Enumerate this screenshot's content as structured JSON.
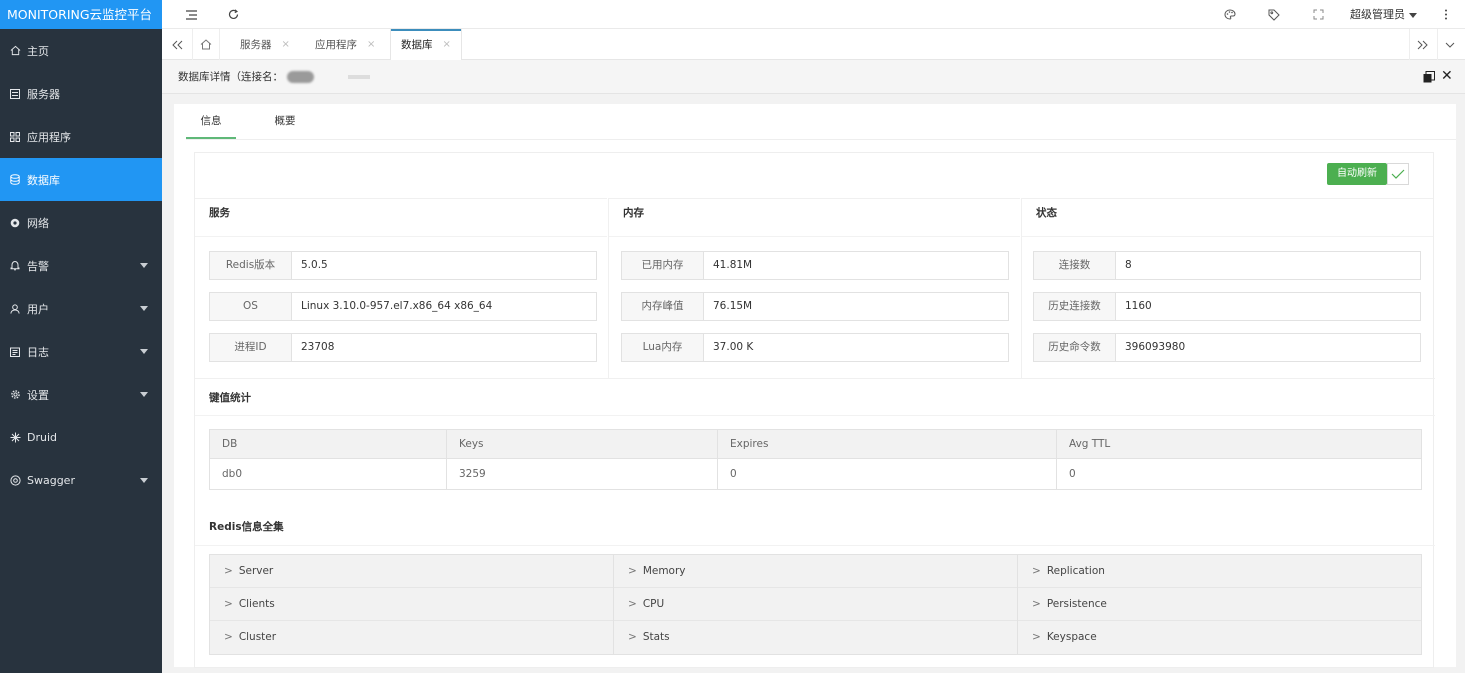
{
  "app": {
    "title": "MONITORING云监控平台"
  },
  "sidebar": {
    "items": [
      {
        "label": "主页",
        "icon": "home-icon"
      },
      {
        "label": "服务器",
        "icon": "server-icon"
      },
      {
        "label": "应用程序",
        "icon": "apps-icon"
      },
      {
        "label": "数据库",
        "icon": "database-icon",
        "active": true
      },
      {
        "label": "网络",
        "icon": "network-icon"
      },
      {
        "label": "告警",
        "icon": "bell-icon",
        "expandable": true
      },
      {
        "label": "用户",
        "icon": "user-icon",
        "expandable": true
      },
      {
        "label": "日志",
        "icon": "log-icon",
        "expandable": true
      },
      {
        "label": "设置",
        "icon": "settings-icon",
        "expandable": true
      },
      {
        "label": "Druid",
        "icon": "druid-icon"
      },
      {
        "label": "Swagger",
        "icon": "swagger-icon",
        "expandable": true
      }
    ]
  },
  "topbar": {
    "admin_label": "超级管理员",
    "icons": [
      "menu-toggle-icon",
      "refresh-icon",
      "palette-icon",
      "tag-icon",
      "fullscreen-icon",
      "more-vertical-icon"
    ]
  },
  "tabs": {
    "items": [
      {
        "label": "服务器"
      },
      {
        "label": "应用程序"
      },
      {
        "label": "数据库",
        "active": true
      }
    ]
  },
  "subheader": {
    "title": "数据库详情（连接名："
  },
  "inner_tabs": [
    {
      "label": "信息",
      "active": true
    },
    {
      "label": "概要"
    }
  ],
  "refresh": {
    "label": "自动刷新"
  },
  "sections": {
    "service": {
      "title": "服务",
      "rows": [
        {
          "k": "Redis版本",
          "v": "5.0.5"
        },
        {
          "k": "OS",
          "v": "Linux 3.10.0-957.el7.x86_64 x86_64"
        },
        {
          "k": "进程ID",
          "v": "23708"
        }
      ]
    },
    "memory": {
      "title": "内存",
      "rows": [
        {
          "k": "已用内存",
          "v": "41.81M"
        },
        {
          "k": "内存峰值",
          "v": "76.15M"
        },
        {
          "k": "Lua内存",
          "v": "37.00 K"
        }
      ]
    },
    "status": {
      "title": "状态",
      "rows": [
        {
          "k": "连接数",
          "v": "8"
        },
        {
          "k": "历史连接数",
          "v": "1160"
        },
        {
          "k": "历史命令数",
          "v": "396093980"
        }
      ]
    },
    "keystats": {
      "title": "键值统计",
      "columns": [
        "DB",
        "Keys",
        "Expires",
        "Avg TTL"
      ],
      "rows": [
        [
          "db0",
          "3259",
          "0",
          "0"
        ]
      ]
    },
    "redisinfo": {
      "title": "Redis信息全集",
      "items": [
        "Server",
        "Memory",
        "Replication",
        "Clients",
        "CPU",
        "Persistence",
        "Cluster",
        "Stats",
        "Keyspace"
      ]
    }
  },
  "colors": {
    "accent": "#2196f3",
    "sidebar_bg": "#28333e",
    "success": "#4caf50",
    "tab_underline": "#5fb878"
  }
}
